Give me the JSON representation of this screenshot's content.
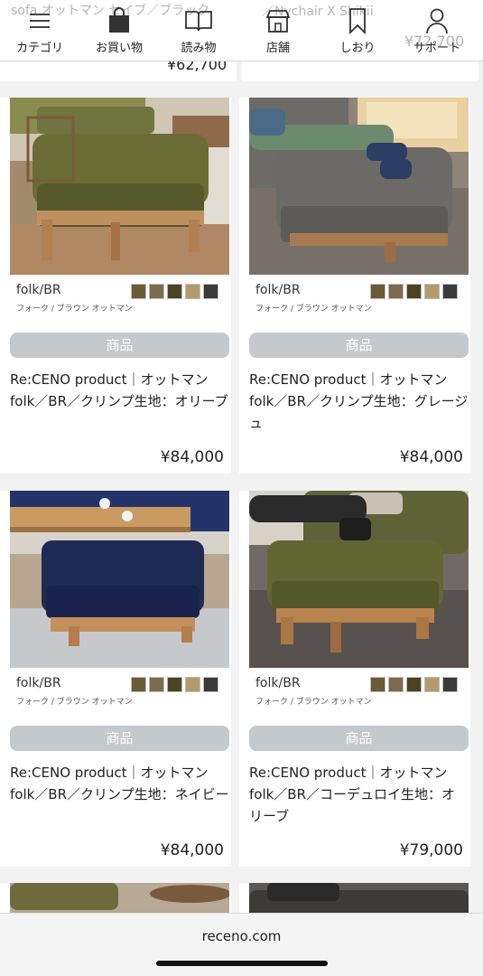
{
  "nav": {
    "ghost_text_left": "sofa オットマン セイブ／ブラック",
    "ghost_text_mid": "／Nychair X Shikii",
    "ghost_price_right": "¥72,700",
    "items": [
      {
        "label": "カテゴリ",
        "icon": "menu-icon"
      },
      {
        "label": "お買い物",
        "icon": "shopping-bag-icon"
      },
      {
        "label": "読み物",
        "icon": "book-icon"
      },
      {
        "label": "店舗",
        "icon": "store-icon"
      },
      {
        "label": "しおり",
        "icon": "bookmark-icon"
      },
      {
        "label": "サポート",
        "icon": "user-icon"
      }
    ]
  },
  "prev_row": {
    "left_price": "¥62,700"
  },
  "products": [
    {
      "model": "folk/BR",
      "sub": "フォーク / ブラウン オットマン",
      "tag": "商品",
      "title": "Re:CENO product｜オットマン folk／BR／クリンプ生地：オリーブ",
      "price": "¥84,000",
      "swatches": [
        "#6b5a36",
        "#7d6b4e",
        "#4d4322",
        "#b59a6a",
        "#3b3b3b"
      ]
    },
    {
      "model": "folk/BR",
      "sub": "フォーク / ブラウン オットマン",
      "tag": "商品",
      "title": "Re:CENO product｜オットマン folk／BR／クリンプ生地：グレージュ",
      "price": "¥84,000",
      "swatches": [
        "#6b5a36",
        "#7d6b4e",
        "#4d4322",
        "#b59a6a",
        "#3b3b3b"
      ]
    },
    {
      "model": "folk/BR",
      "sub": "フォーク / ブラウン オットマン",
      "tag": "商品",
      "title": "Re:CENO product｜オットマン folk／BR／クリンプ生地：ネイビー",
      "price": "¥84,000",
      "swatches": [
        "#6b5a36",
        "#7d6b4e",
        "#4d4322",
        "#b59a6a",
        "#3b3b3b"
      ]
    },
    {
      "model": "folk/BR",
      "sub": "フォーク / ブラウン オットマン",
      "tag": "商品",
      "title": "Re:CENO product｜オットマン folk／BR／コーデュロイ生地：オリーブ",
      "price": "¥79,000",
      "swatches": [
        "#6b5a36",
        "#7d6b4e",
        "#4d4322",
        "#b59a6a",
        "#3b3b3b"
      ]
    }
  ],
  "browser": {
    "url": "receno.com"
  }
}
